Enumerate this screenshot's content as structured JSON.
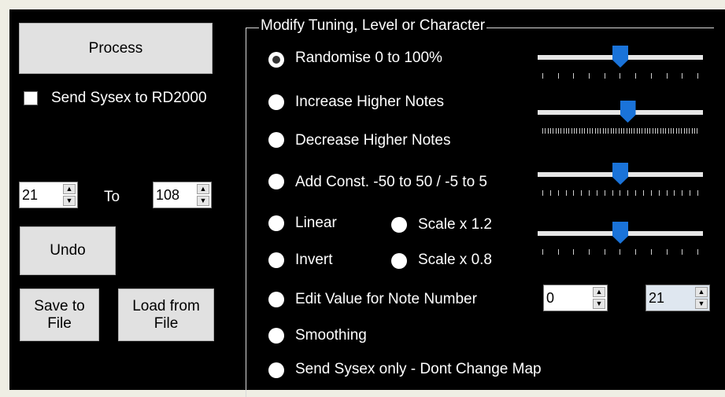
{
  "left": {
    "process_label": "Process",
    "send_sysex_label": "Send Sysex to RD2000",
    "range_from": "21",
    "range_to_label": "To",
    "range_to": "108",
    "undo_label": "Undo",
    "save_label": "Save to File",
    "load_label": "Load from File"
  },
  "group": {
    "title": "Modify Tuning, Level or Character",
    "options": {
      "randomise": "Randomise 0 to 100%",
      "increase": "Increase Higher Notes",
      "decrease": "Decrease Higher Notes",
      "add_const": "Add Const. -50 to 50 / -5 to 5",
      "linear": "Linear",
      "scale12": "Scale x 1.2",
      "invert": "Invert",
      "scale08": "Scale x 0.8",
      "edit_value": "Edit Value for Note Number",
      "smoothing": "Smoothing",
      "send_only": "Send Sysex only - Dont Change Map"
    },
    "edit_value": "0",
    "note_number": "21",
    "selected_option": "randomise",
    "sliders": [
      {
        "name": "randomise",
        "level": 0.5,
        "ticks": 11
      },
      {
        "name": "higher-notes",
        "level": 0.55,
        "ticks": 60
      },
      {
        "name": "add-const",
        "level": 0.5,
        "ticks": 21
      },
      {
        "name": "scale",
        "level": 0.5,
        "ticks": 11
      }
    ]
  },
  "colors": {
    "panel": "#000000",
    "thumb": "#1a73d9",
    "background": "#efeee4"
  }
}
